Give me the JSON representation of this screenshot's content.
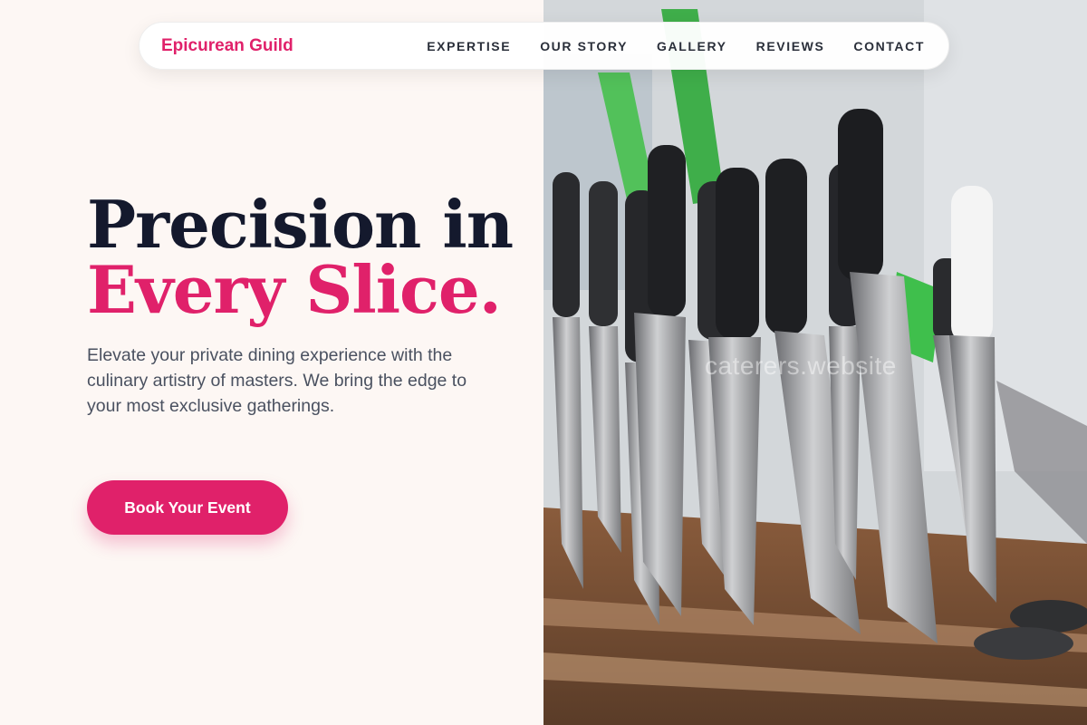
{
  "brand": "Epicurean Guild",
  "nav": [
    "EXPERTISE",
    "OUR STORY",
    "GALLERY",
    "REVIEWS",
    "CONTACT"
  ],
  "hero": {
    "line1": "Precision in",
    "line2": "Every Slice.",
    "description": "Elevate your private dining experience with the culinary artistry of masters. We bring the edge to your most exclusive gatherings.",
    "cta": "Book Your Event"
  },
  "watermark": "caterers.website",
  "colors": {
    "accent": "#e0216a",
    "heading": "#14192d",
    "background": "#fdf7f4",
    "body_text": "#4a5160"
  },
  "image": {
    "subject": "knife-block-photo"
  }
}
